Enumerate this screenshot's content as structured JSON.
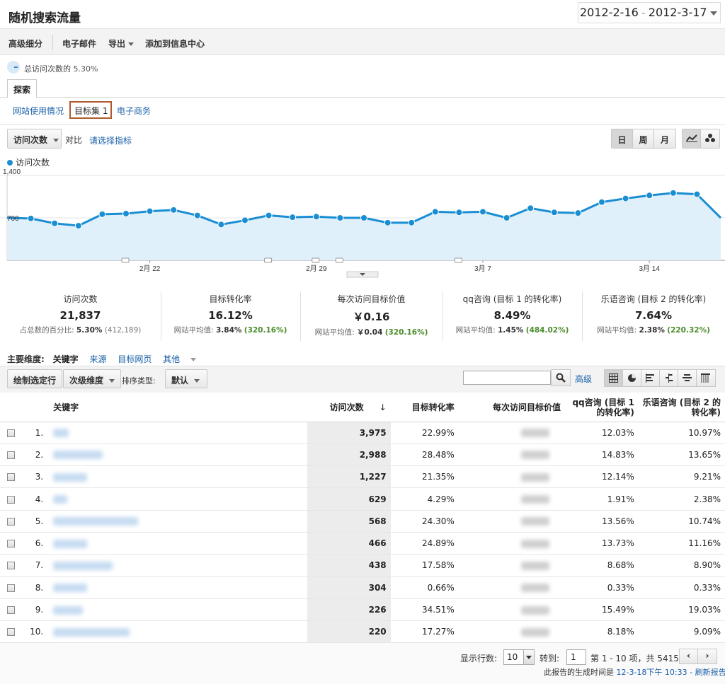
{
  "header": {
    "title": "随机搜索流量",
    "date_start": "2012-2-16",
    "date_sep": " - ",
    "date_end": "2012-3-17"
  },
  "toolbar": {
    "advanced_segment": "高级细分",
    "email": "电子邮件",
    "export": "导出",
    "add_to_dashboard": "添加到信息中心"
  },
  "segment": {
    "label": "总访问次数的",
    "percent": "5.30%"
  },
  "tabs": {
    "explore": "探索",
    "subtabs": [
      "网站使用情况",
      "目标集 1",
      "电子商务"
    ]
  },
  "metric_bar": {
    "metric": "访问次数",
    "vs": "对比",
    "choose": "请选择指标",
    "period_buttons": [
      "日",
      "周",
      "月"
    ]
  },
  "chart_data": {
    "type": "area",
    "series_name": "访问次数",
    "y_ticks": [
      "1,400",
      "700"
    ],
    "ylim": [
      0,
      1400
    ],
    "x_tick_labels": [
      "2月 22",
      "2月 29",
      "3月 7",
      "3月 14"
    ],
    "x": [
      "2012-2-16",
      "2012-2-17",
      "2012-2-18",
      "2012-2-19",
      "2012-2-20",
      "2012-2-21",
      "2012-2-22",
      "2012-2-23",
      "2012-2-24",
      "2012-2-25",
      "2012-2-26",
      "2012-2-27",
      "2012-2-28",
      "2012-2-29",
      "2012-3-1",
      "2012-3-2",
      "2012-3-3",
      "2012-3-4",
      "2012-3-5",
      "2012-3-6",
      "2012-3-7",
      "2012-3-8",
      "2012-3-9",
      "2012-3-10",
      "2012-3-11",
      "2012-3-12",
      "2012-3-13",
      "2012-3-14",
      "2012-3-15",
      "2012-3-16",
      "2012-3-17"
    ],
    "values": [
      700,
      690,
      610,
      570,
      760,
      770,
      810,
      830,
      740,
      590,
      660,
      740,
      710,
      720,
      700,
      700,
      620,
      620,
      800,
      790,
      800,
      700,
      860,
      790,
      780,
      960,
      1020,
      1070,
      1110,
      1090,
      700
    ],
    "color": "#1a8ed3",
    "fill": "#dff0fa",
    "annotation_marker_dates": [
      "2012-2-21",
      "2012-2-27",
      "2012-2-29",
      "2012-3-1",
      "2012-3-6"
    ]
  },
  "scorecards": [
    {
      "label": "访问次数",
      "value": "21,837",
      "sub_prefix": "占总数的百分比:",
      "sub_value": "5.30%",
      "sub_extra": "(412,189)",
      "extra_style": "gray"
    },
    {
      "label": "目标转化率",
      "value": "16.12%",
      "sub_prefix": "网站平均值:",
      "sub_value": "3.84%",
      "sub_extra": "(320.16%)",
      "extra_style": "green"
    },
    {
      "label": "每次访问目标价值",
      "value": "￥0.16",
      "sub_prefix": "网站平均值:",
      "sub_value": "￥0.04",
      "sub_extra": "(320.16%)",
      "extra_style": "green"
    },
    {
      "label": "qq咨询 (目标 1 的转化率)",
      "value": "8.49%",
      "sub_prefix": "网站平均值:",
      "sub_value": "1.45%",
      "sub_extra": "(484.02%)",
      "extra_style": "green"
    },
    {
      "label": "乐语咨询 (目标 2 的转化率)",
      "value": "7.64%",
      "sub_prefix": "网站平均值:",
      "sub_value": "2.38%",
      "sub_extra": "(220.32%)",
      "extra_style": "green"
    }
  ],
  "dimensions": {
    "label": "主要维度:",
    "items": [
      "关键字",
      "来源",
      "目标网页",
      "其他"
    ]
  },
  "tablebar": {
    "plot_rows": "绘制选定行",
    "secondary_dim": "次级维度",
    "sort_type_label": "排序类型:",
    "sort_default": "默认",
    "advanced": "高级"
  },
  "table": {
    "headers": [
      "关键字",
      "访问次数",
      "目标转化率",
      "每次访问目标价值",
      "qq咨询 (目标 1 的转化率)",
      "乐语咨询 (目标 2 的转化率)"
    ],
    "rows": [
      {
        "idx": "1.",
        "visits": "3,975",
        "conv": "22.99%",
        "qq": "12.03%",
        "ly": "10.97%"
      },
      {
        "idx": "2.",
        "visits": "2,988",
        "conv": "28.48%",
        "qq": "14.83%",
        "ly": "13.65%"
      },
      {
        "idx": "3.",
        "visits": "1,227",
        "conv": "21.35%",
        "qq": "12.14%",
        "ly": "9.21%"
      },
      {
        "idx": "4.",
        "visits": "629",
        "conv": "4.29%",
        "qq": "1.91%",
        "ly": "2.38%"
      },
      {
        "idx": "5.",
        "visits": "568",
        "conv": "24.30%",
        "qq": "13.56%",
        "ly": "10.74%"
      },
      {
        "idx": "6.",
        "visits": "466",
        "conv": "24.89%",
        "qq": "13.73%",
        "ly": "11.16%"
      },
      {
        "idx": "7.",
        "visits": "438",
        "conv": "17.58%",
        "qq": "8.68%",
        "ly": "8.90%"
      },
      {
        "idx": "8.",
        "visits": "304",
        "conv": "0.66%",
        "qq": "0.33%",
        "ly": "0.33%"
      },
      {
        "idx": "9.",
        "visits": "226",
        "conv": "34.51%",
        "qq": "15.49%",
        "ly": "19.03%"
      },
      {
        "idx": "10.",
        "visits": "220",
        "conv": "17.27%",
        "qq": "8.18%",
        "ly": "9.09%"
      }
    ]
  },
  "footer": {
    "rows_label": "显示行数:",
    "rows_value": "10",
    "goto_label": "转到:",
    "goto_value": "1",
    "range_text": "第 1 - 10 项，共 5415 项",
    "prev": "‹",
    "next": "›",
    "generated_prefix": "此报告的生成时间是",
    "generated_time": "12-3-18下午 10:33",
    "refresh": "- 刷新报告"
  }
}
